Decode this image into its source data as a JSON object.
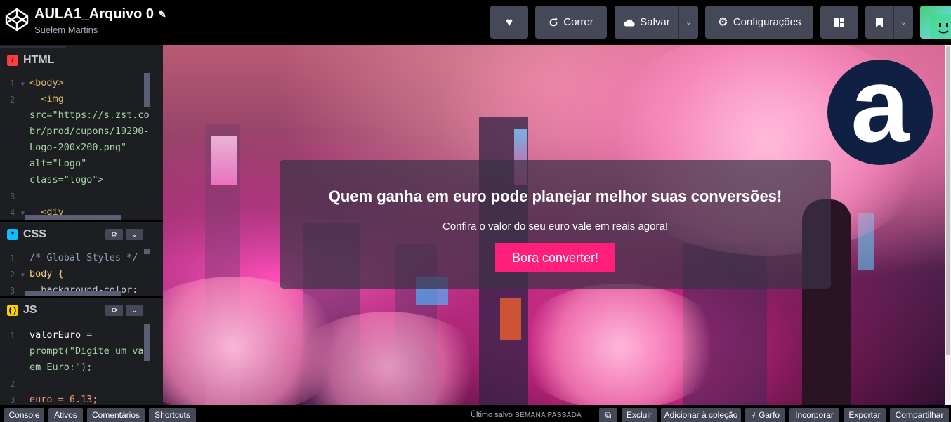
{
  "header": {
    "title": "AULA1_Arquivo 0",
    "author": "Suelem Martins",
    "pencil_icon": "✎",
    "buttons": {
      "like_icon": "♥",
      "run_label": "Correr",
      "save_label": "Salvar",
      "settings_label": "Configurações"
    }
  },
  "editors": {
    "html": {
      "label": "HTML",
      "lines": [
        "1",
        "2",
        "",
        "",
        "",
        "",
        "3",
        "4"
      ],
      "code": [
        "<body>",
        "  <img",
        "src=\"https://s.zst.co",
        "br/prod/cupons/19290-",
        "Logo-200x200.png\"",
        "alt=\"Logo\"",
        "class=\"logo\">",
        "",
        "  <div"
      ]
    },
    "css": {
      "label": "CSS",
      "lines": [
        "1",
        "2",
        "3"
      ],
      "code": [
        "/* Global Styles */",
        "body {",
        "  background-color:"
      ]
    },
    "js": {
      "label": "JS",
      "lines": [
        "1",
        "",
        "",
        "2",
        "3"
      ],
      "code": [
        "valorEuro =",
        "prompt(\"Digite um va",
        "em Euro:\");",
        "",
        "euro = 6.13;"
      ]
    }
  },
  "preview": {
    "logo_letter": "a",
    "headline": "Quem ganha em euro pode planejar melhor suas conversões!",
    "subtext": "Confira o valor do seu euro vale em reais agora!",
    "cta": "Bora converter!",
    "cta_color": "#ff1f7a"
  },
  "footer": {
    "console": "Console",
    "assets": "Ativos",
    "comments": "Comentários",
    "shortcuts": "Shortcuts",
    "saved_prefix": "Último salvo",
    "saved_time": "SEMANA PASSADA",
    "delete": "Excluir",
    "add_collection": "Adicionar à coleção",
    "fork": "Garfo",
    "embed": "Incorporar",
    "export": "Exportar",
    "share": "Compartilhar"
  }
}
